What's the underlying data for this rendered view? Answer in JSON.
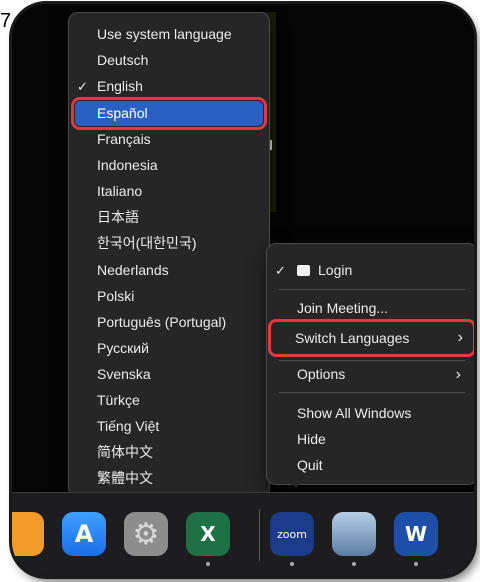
{
  "page_marker": "7.",
  "language_menu": {
    "items": [
      {
        "label": "Use system language",
        "checked": false
      },
      {
        "label": "Deutsch",
        "checked": false
      },
      {
        "label": "English",
        "checked": true
      },
      {
        "label": "Español",
        "checked": false,
        "highlighted": true
      },
      {
        "label": "Français",
        "checked": false
      },
      {
        "label": "Indonesia",
        "checked": false
      },
      {
        "label": "Italiano",
        "checked": false
      },
      {
        "label": "日本語",
        "checked": false
      },
      {
        "label": "한국어(대한민국)",
        "checked": false
      },
      {
        "label": "Nederlands",
        "checked": false
      },
      {
        "label": "Polski",
        "checked": false
      },
      {
        "label": "Português (Portugal)",
        "checked": false
      },
      {
        "label": "Русский",
        "checked": false
      },
      {
        "label": "Svenska",
        "checked": false
      },
      {
        "label": "Türkçe",
        "checked": false
      },
      {
        "label": "Tiếng Việt",
        "checked": false
      },
      {
        "label": "简体中文",
        "checked": false
      },
      {
        "label": "繁體中文",
        "checked": false
      }
    ],
    "check_glyph": "✓"
  },
  "context_menu": {
    "login": {
      "label": "Login",
      "checked": true
    },
    "join_meeting": "Join Meeting...",
    "switch_languages": "Switch Languages",
    "options": "Options",
    "show_all_windows": "Show All Windows",
    "hide": "Hide",
    "quit": "Quit",
    "submenu_glyph": "›"
  },
  "dock": {
    "apps": [
      {
        "name": "Books",
        "icon": "book-icon"
      },
      {
        "name": "App Store",
        "icon": "app-store-icon",
        "glyph": "A"
      },
      {
        "name": "System Settings",
        "icon": "gear-icon",
        "glyph": "⚙"
      },
      {
        "name": "Microsoft Excel",
        "icon": "excel-icon",
        "glyph": "X"
      },
      {
        "name": "Zoom",
        "icon": "zoom-icon",
        "glyph": "zoom"
      },
      {
        "name": "Preview",
        "icon": "preview-icon"
      },
      {
        "name": "Microsoft Word",
        "icon": "word-icon",
        "glyph": "W"
      }
    ]
  },
  "colors": {
    "highlight_blue": "#2a5fc4",
    "callout_red": "#e0393e",
    "menu_bg": "#262626"
  }
}
